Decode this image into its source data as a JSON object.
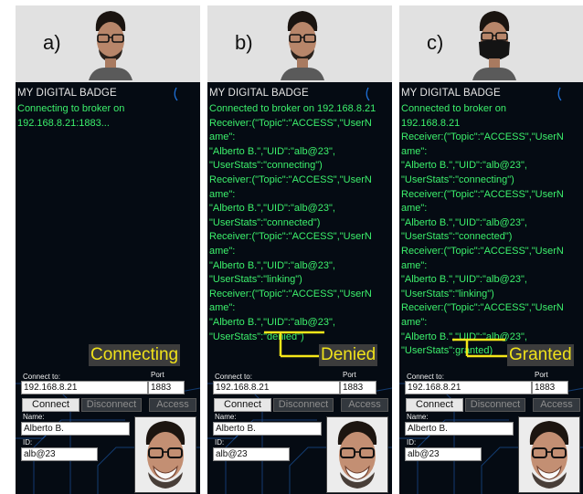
{
  "colors": {
    "log_text": "#3cf06c",
    "status_text": "#f0e21a",
    "status_bg": "#3c3c3c",
    "screen_bg": "#050b13",
    "connector": "#f5e619"
  },
  "panels": [
    {
      "letter": "a)",
      "app_title": "MY DIGITAL BADGE",
      "log": [
        "Connecting to broker on",
        "192.168.8.21:1883..."
      ],
      "status": "Connecting",
      "form": {
        "connect_to_label": "Connect to:",
        "host_value": "192.168.8.21",
        "port_label": "Port",
        "port_value": "1883",
        "connect_button": "Connect",
        "disconnect_button": "Disconnect",
        "access_button": "Access",
        "name_label": "Name:",
        "name_value": "Alberto B.",
        "id_label": "ID:",
        "id_value": "alb@23"
      }
    },
    {
      "letter": "b)",
      "app_title": "MY DIGITAL BADGE",
      "log": [
        "Connected to broker on 192.168.8.21",
        "Receiver:(\"Topic\":\"ACCESS\",\"UserN",
        "ame\":",
        "\"Alberto B.\",\"UID\":\"alb@23\",",
        "\"UserStats\":\"connecting\")",
        "Receiver:(\"Topic\":\"ACCESS\",\"UserN",
        "ame\":",
        "\"Alberto B.\",\"UID\":\"alb@23\",",
        "\"UserStats\":\"connected\")",
        "Receiver:(\"Topic\":\"ACCESS\",\"UserN",
        "ame\":",
        "\"Alberto B.\",\"UID\":\"alb@23\",",
        "\"UserStats\":\"linking\")",
        "Receiver:(\"Topic\":\"ACCESS\",\"UserN",
        "ame\":",
        "\"Alberto B.\",\"UID\":\"alb@23\",",
        "\"UserStats\":\"denied\")"
      ],
      "status": "Denied",
      "form": {
        "connect_to_label": "Connect to:",
        "host_value": "192.168.8.21",
        "port_label": "Port",
        "port_value": "1883",
        "connect_button": "Connect",
        "disconnect_button": "Disconnect",
        "access_button": "Access",
        "name_label": "Name:",
        "name_value": "Alberto B.",
        "id_label": "ID:",
        "id_value": "alb@23"
      }
    },
    {
      "letter": "c)",
      "app_title": "MY DIGITAL BADGE",
      "log": [
        "Connected to broker on",
        "192.168.8.21",
        "Receiver:(\"Topic\":\"ACCESS\",\"UserN",
        "ame\":",
        "\"Alberto B.\",\"UID\":\"alb@23\",",
        "\"UserStats\":\"connecting\")",
        "Receiver:(\"Topic\":\"ACCESS\",\"UserN",
        "ame\":",
        "\"Alberto B.\",\"UID\":\"alb@23\",",
        "\"UserStats\":\"connected\")",
        "Receiver:(\"Topic\":\"ACCESS\",\"UserN",
        "ame\":",
        "\"Alberto B.\",\"UID\":\"alb@23\",",
        "\"UserStats\":\"linking\")",
        "Receiver:(\"Topic\":\"ACCESS\",\"UserN",
        "ame\":",
        "\"Alberto B.\",\"UID\":\"alb@23\",",
        "\"UserStats\":granted)"
      ],
      "status": "Granted",
      "form": {
        "connect_to_label": "Connect to:",
        "host_value": "192.168.8.21",
        "port_label": "Port",
        "port_value": "1883",
        "connect_button": "Connect",
        "disconnect_button": "Disconnect",
        "access_button": "Access",
        "name_label": "Name:",
        "name_value": "Alberto B.",
        "id_label": "ID:",
        "id_value": "alb@23"
      }
    }
  ]
}
